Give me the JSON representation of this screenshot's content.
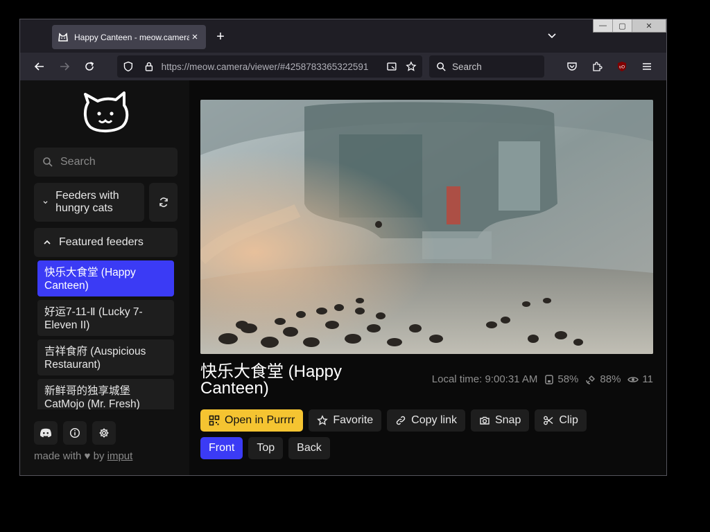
{
  "browser": {
    "tab_title": "Happy Canteen - meow.camera",
    "url": "https://meow.camera/viewer/#4258783365322591",
    "search_placeholder": "Search"
  },
  "sidebar": {
    "search_placeholder": "Search",
    "group_selector_label": "Feeders with hungry cats",
    "featured_label": "Featured feeders",
    "feeders": [
      {
        "label": "快乐大食堂 (Happy Canteen)",
        "active": true
      },
      {
        "label": "好运7-11-Ⅱ (Lucky 7-Eleven II)",
        "active": false
      },
      {
        "label": "吉祥食府 (Auspicious Restaurant)",
        "active": false
      },
      {
        "label": "新鲜哥的独享城堡 CatMojo (Mr. Fresh)",
        "active": false
      }
    ],
    "footer": {
      "made_with": "made with",
      "by": "by",
      "author": "imput"
    }
  },
  "viewer": {
    "title": "快乐大食堂 (Happy Canteen)",
    "local_time": "Local time: 9:00:31 AM",
    "food_level": "58%",
    "signal": "88%",
    "viewers": "11",
    "actions": {
      "open": "Open in Purrrr",
      "favorite": "Favorite",
      "copy_link": "Copy link",
      "snap": "Snap",
      "clip": "Clip"
    },
    "views": {
      "front": "Front",
      "top": "Top",
      "back": "Back"
    }
  },
  "colors": {
    "accent": "#3b3bf5",
    "primary_button": "#f5c431",
    "background": "#0a0a0a"
  }
}
